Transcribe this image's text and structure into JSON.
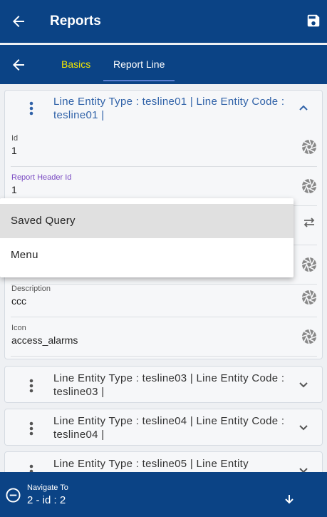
{
  "header": {
    "title": "Reports"
  },
  "tabs": [
    {
      "label": "Basics"
    },
    {
      "label": "Report Line"
    }
  ],
  "line_cards": [
    {
      "title": "Line Entity Type : tesline01 | Line Entity Code : tesline01 |",
      "expanded": true
    },
    {
      "title": "Line Entity Type : tesline03 | Line Entity Code : tesline03 |",
      "expanded": false
    },
    {
      "title": "Line Entity Type : tesline04 | Line Entity Code : tesline04 |",
      "expanded": false
    },
    {
      "title": "Line Entity Type : tesline05 | Line Entity",
      "expanded": false
    }
  ],
  "fields": [
    {
      "label": "Id",
      "value": "1"
    },
    {
      "label": "Report Header Id",
      "value": "1"
    },
    {
      "label": "Description",
      "value": "ccc"
    },
    {
      "label": "Icon",
      "value": "access_alarms"
    }
  ],
  "menu": {
    "items": [
      "Saved Query",
      "Menu"
    ]
  },
  "footer": {
    "label": "Navigate To",
    "value": "2 - id : 2"
  },
  "colors": {
    "primary": "#0b4385",
    "tab_active": "#f2e600",
    "link_text": "#3062a8"
  }
}
